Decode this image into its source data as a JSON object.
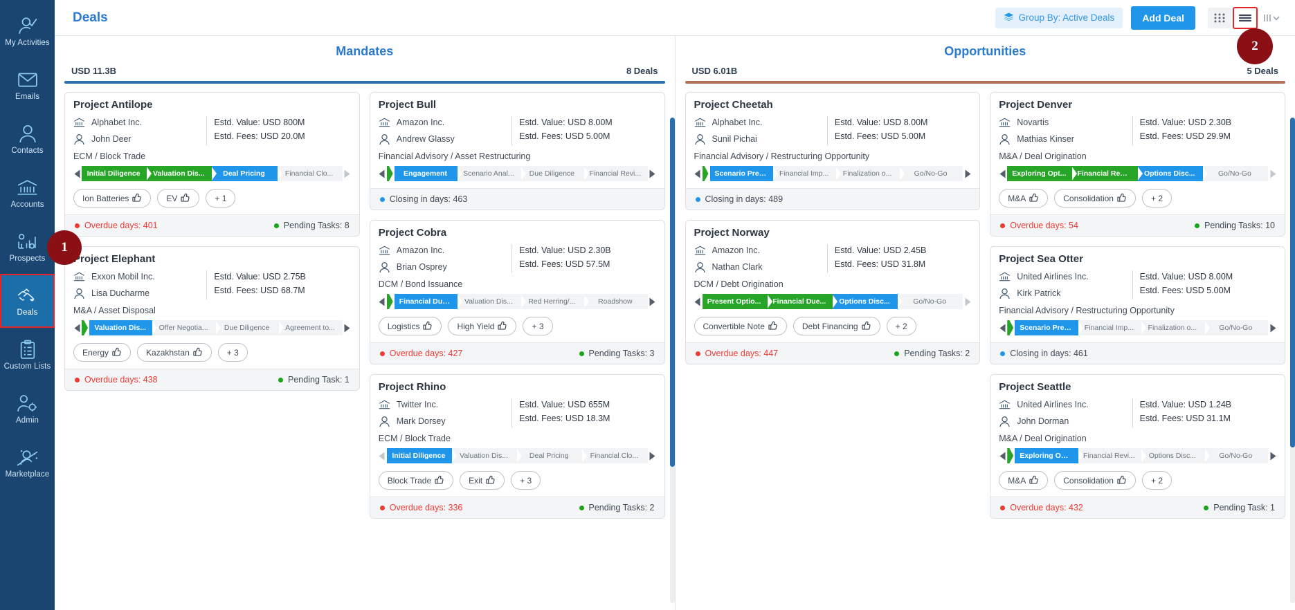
{
  "sidebar": {
    "items": [
      {
        "label": "My Activities",
        "icon": "user-check-icon",
        "active": false
      },
      {
        "label": "Emails",
        "icon": "envelope-icon",
        "active": false
      },
      {
        "label": "Contacts",
        "icon": "person-icon",
        "active": false
      },
      {
        "label": "Accounts",
        "icon": "bank-icon",
        "active": false
      },
      {
        "label": "Prospects",
        "icon": "chart-gear-icon",
        "active": false
      },
      {
        "label": "Deals",
        "icon": "handshake-check-icon",
        "active": true
      },
      {
        "label": "Custom Lists",
        "icon": "clipboard-list-icon",
        "active": false
      },
      {
        "label": "Admin",
        "icon": "person-gear-icon",
        "active": false
      },
      {
        "label": "Marketplace",
        "icon": "person-network-icon",
        "active": false
      }
    ]
  },
  "annotations": {
    "badge1": "1",
    "badge2": "2"
  },
  "topbar": {
    "title": "Deals",
    "group_by_label": "Group By: Active Deals",
    "group_by_icon": "layers-icon",
    "add_deal_label": "Add Deal",
    "view_grid_icon": "grid-view-icon",
    "view_list_icon": "list-view-icon",
    "view_columns_icon": "columns-view-icon",
    "chevron_icon": "chevron-down-icon"
  },
  "columns": [
    {
      "title": "Mandates",
      "amount": "USD 11.3B",
      "deal_count": "8 Deals",
      "rule_color": "#2a6fb0",
      "scroll_thumb_pct": 72,
      "lanes": [
        {
          "cards": [
            {
              "title": "Project Antilope",
              "account": "Alphabet Inc.",
              "contact": "John Deer",
              "est_value_label": "Estd. Value:",
              "est_value": "USD 800M",
              "est_fees_label": "Estd. Fees:",
              "est_fees": "USD 20.0M",
              "sector": "ECM / Block Trade",
              "left_arrow": "solid",
              "right_arrow": "dim",
              "lead_green": false,
              "stages": [
                {
                  "label": "Initial Diligence",
                  "state": "done"
                },
                {
                  "label": "Valuation Dis...",
                  "state": "done"
                },
                {
                  "label": "Deal Pricing",
                  "state": "cur"
                },
                {
                  "label": "Financial Clo...",
                  "state": "todo"
                }
              ],
              "tags": [
                "Ion Batteries",
                "EV"
              ],
              "tag_more": "+ 1",
              "status_type": "overdue",
              "status_text": "Overdue days: 401",
              "pending_text": "Pending Tasks: 8"
            },
            {
              "title": "Project Elephant",
              "account": "Exxon Mobil Inc.",
              "contact": "Lisa Ducharme",
              "est_value_label": "Estd. Value:",
              "est_value": "USD 2.75B",
              "est_fees_label": "Estd. Fees:",
              "est_fees": "USD 68.7M",
              "sector": "M&A / Asset Disposal",
              "left_arrow": "solid",
              "right_arrow": "solid",
              "lead_green": true,
              "stages": [
                {
                  "label": "Valuation Dis...",
                  "state": "cur"
                },
                {
                  "label": "Offer Negotia...",
                  "state": "todo"
                },
                {
                  "label": "Due Diligence",
                  "state": "todo"
                },
                {
                  "label": "Agreement to...",
                  "state": "todo"
                }
              ],
              "tags": [
                "Energy",
                "Kazakhstan"
              ],
              "tag_more": "+ 3",
              "status_type": "overdue",
              "status_text": "Overdue days: 438",
              "pending_text": "Pending Task: 1"
            }
          ]
        },
        {
          "cards": [
            {
              "title": "Project Bull",
              "account": "Amazon Inc.",
              "contact": "Andrew Glassy",
              "est_value_label": "Estd. Value:",
              "est_value": "USD 8.00M",
              "est_fees_label": "Estd. Fees:",
              "est_fees": "USD 5.00M",
              "sector": "Financial Advisory / Asset Restructuring",
              "left_arrow": "solid",
              "right_arrow": "solid",
              "lead_green": true,
              "stages": [
                {
                  "label": "Engagement",
                  "state": "cur"
                },
                {
                  "label": "Scenario Anal...",
                  "state": "todo"
                },
                {
                  "label": "Due Diligence",
                  "state": "todo"
                },
                {
                  "label": "Financial Revi...",
                  "state": "todo"
                }
              ],
              "tags": [],
              "tag_more": "",
              "status_type": "closing",
              "status_text": "Closing in days: 463",
              "pending_text": ""
            },
            {
              "title": "Project Cobra",
              "account": "Amazon Inc.",
              "contact": "Brian Osprey",
              "est_value_label": "Estd. Value:",
              "est_value": "USD 2.30B",
              "est_fees_label": "Estd. Fees:",
              "est_fees": "USD 57.5M",
              "sector": "DCM / Bond Issuance",
              "left_arrow": "solid",
              "right_arrow": "solid",
              "lead_green": true,
              "stages": [
                {
                  "label": "Financial Due...",
                  "state": "cur"
                },
                {
                  "label": "Valuation Dis...",
                  "state": "todo"
                },
                {
                  "label": "Red Herring/...",
                  "state": "todo"
                },
                {
                  "label": "Roadshow",
                  "state": "todo"
                }
              ],
              "tags": [
                "Logistics",
                "High Yield"
              ],
              "tag_more": "+ 3",
              "status_type": "overdue",
              "status_text": "Overdue days: 427",
              "pending_text": "Pending Tasks: 3"
            },
            {
              "title": "Project Rhino",
              "account": "Twitter Inc.",
              "contact": "Mark Dorsey",
              "est_value_label": "Estd. Value:",
              "est_value": "USD 655M",
              "est_fees_label": "Estd. Fees:",
              "est_fees": "USD 18.3M",
              "sector": "ECM / Block Trade",
              "left_arrow": "dim",
              "right_arrow": "solid",
              "lead_green": false,
              "stages": [
                {
                  "label": "Initial Diligence",
                  "state": "cur"
                },
                {
                  "label": "Valuation Dis...",
                  "state": "todo"
                },
                {
                  "label": "Deal Pricing",
                  "state": "todo"
                },
                {
                  "label": "Financial Clo...",
                  "state": "todo"
                }
              ],
              "tags": [
                "Block Trade",
                "Exit"
              ],
              "tag_more": "+ 3",
              "status_type": "overdue",
              "status_text": "Overdue days: 336",
              "pending_text": "Pending Tasks: 2"
            }
          ]
        }
      ]
    },
    {
      "title": "Opportunities",
      "amount": "USD 6.01B",
      "deal_count": "5 Deals",
      "rule_color": "#b5715c",
      "scroll_thumb_pct": 68,
      "lanes": [
        {
          "cards": [
            {
              "title": "Project Cheetah",
              "account": "Alphabet Inc.",
              "contact": "Sunil Pichai",
              "est_value_label": "Estd. Value:",
              "est_value": "USD 8.00M",
              "est_fees_label": "Estd. Fees:",
              "est_fees": "USD 5.00M",
              "sector": "Financial Advisory / Restructuring Opportunity",
              "left_arrow": "solid",
              "right_arrow": "solid",
              "lead_green": true,
              "stages": [
                {
                  "label": "Scenario Pres...",
                  "state": "cur"
                },
                {
                  "label": "Financial Imp...",
                  "state": "todo"
                },
                {
                  "label": "Finalization o...",
                  "state": "todo"
                },
                {
                  "label": "Go/No-Go",
                  "state": "todo"
                }
              ],
              "tags": [],
              "tag_more": "",
              "status_type": "closing",
              "status_text": "Closing in days: 489",
              "pending_text": ""
            },
            {
              "title": "Project Norway",
              "account": "Amazon Inc.",
              "contact": "Nathan Clark",
              "est_value_label": "Estd. Value:",
              "est_value": "USD 2.45B",
              "est_fees_label": "Estd. Fees:",
              "est_fees": "USD 31.8M",
              "sector": "DCM / Debt Origination",
              "left_arrow": "solid",
              "right_arrow": "dim",
              "lead_green": false,
              "stages": [
                {
                  "label": "Present Optio...",
                  "state": "done"
                },
                {
                  "label": "Financial Due...",
                  "state": "done"
                },
                {
                  "label": "Options Disc...",
                  "state": "cur"
                },
                {
                  "label": "Go/No-Go",
                  "state": "todo"
                }
              ],
              "tags": [
                "Convertible Note",
                "Debt Financing"
              ],
              "tag_more": "+ 2",
              "status_type": "overdue",
              "status_text": "Overdue days: 447",
              "pending_text": "Pending Tasks: 2"
            }
          ]
        },
        {
          "cards": [
            {
              "title": "Project Denver",
              "account": "Novartis",
              "contact": "Mathias Kinser",
              "est_value_label": "Estd. Value:",
              "est_value": "USD 2.30B",
              "est_fees_label": "Estd. Fees:",
              "est_fees": "USD 29.9M",
              "sector": "M&A / Deal Origination",
              "left_arrow": "solid",
              "right_arrow": "dim",
              "lead_green": false,
              "stages": [
                {
                  "label": "Exploring Opt...",
                  "state": "done"
                },
                {
                  "label": "Financial Revi...",
                  "state": "done"
                },
                {
                  "label": "Options Disc...",
                  "state": "cur"
                },
                {
                  "label": "Go/No-Go",
                  "state": "todo"
                }
              ],
              "tags": [
                "M&A",
                "Consolidation"
              ],
              "tag_more": "+ 2",
              "status_type": "overdue",
              "status_text": "Overdue days: 54",
              "pending_text": "Pending Tasks: 10"
            },
            {
              "title": "Project Sea Otter",
              "account": "United Airlines Inc.",
              "contact": "Kirk Patrick",
              "est_value_label": "Estd. Value:",
              "est_value": "USD 8.00M",
              "est_fees_label": "Estd. Fees:",
              "est_fees": "USD 5.00M",
              "sector": "Financial Advisory / Restructuring Opportunity",
              "left_arrow": "solid",
              "right_arrow": "solid",
              "lead_green": true,
              "stages": [
                {
                  "label": "Scenario Pres...",
                  "state": "cur"
                },
                {
                  "label": "Financial Imp...",
                  "state": "todo"
                },
                {
                  "label": "Finalization o...",
                  "state": "todo"
                },
                {
                  "label": "Go/No-Go",
                  "state": "todo"
                }
              ],
              "tags": [],
              "tag_more": "",
              "status_type": "closing",
              "status_text": "Closing in days: 461",
              "pending_text": ""
            },
            {
              "title": "Project Seattle",
              "account": "United Airlines Inc.",
              "contact": "John Dorman",
              "est_value_label": "Estd. Value:",
              "est_value": "USD 1.24B",
              "est_fees_label": "Estd. Fees:",
              "est_fees": "USD 31.1M",
              "sector": "M&A / Deal Origination",
              "left_arrow": "solid",
              "right_arrow": "solid",
              "lead_green": true,
              "stages": [
                {
                  "label": "Exploring Opt...",
                  "state": "cur"
                },
                {
                  "label": "Financial Revi...",
                  "state": "todo"
                },
                {
                  "label": "Options Disc...",
                  "state": "todo"
                },
                {
                  "label": "Go/No-Go",
                  "state": "todo"
                }
              ],
              "tags": [
                "M&A",
                "Consolidation"
              ],
              "tag_more": "+ 2",
              "status_type": "overdue",
              "status_text": "Overdue days: 432",
              "pending_text": "Pending Task: 1"
            }
          ]
        }
      ]
    }
  ]
}
